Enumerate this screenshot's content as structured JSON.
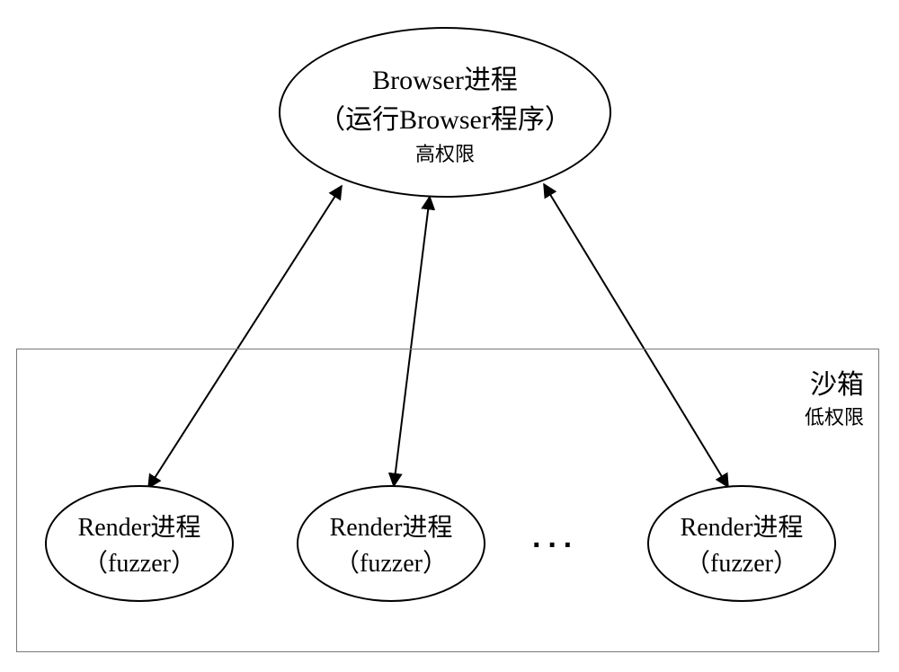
{
  "diagram": {
    "top_node": {
      "line1": "Browser进程",
      "line2": "（运行Browser程序）",
      "line3": "高权限"
    },
    "sandbox": {
      "title": "沙箱",
      "subtitle": "低权限"
    },
    "render_nodes": [
      {
        "line1": "Render进程",
        "line2": "（fuzzer）"
      },
      {
        "line1": "Render进程",
        "line2": "（fuzzer）"
      },
      {
        "line1": "Render进程",
        "line2": "（fuzzer）"
      }
    ],
    "ellipsis": "···",
    "relationships": {
      "description": "Bidirectional communication between high-privilege Browser process and multiple low-privilege sandboxed Render (fuzzer) processes",
      "edges": [
        {
          "from": "Browser进程",
          "to": "Render进程 1",
          "bidirectional": true
        },
        {
          "from": "Browser进程",
          "to": "Render进程 2",
          "bidirectional": true
        },
        {
          "from": "Browser进程",
          "to": "Render进程 3",
          "bidirectional": true
        }
      ]
    }
  }
}
